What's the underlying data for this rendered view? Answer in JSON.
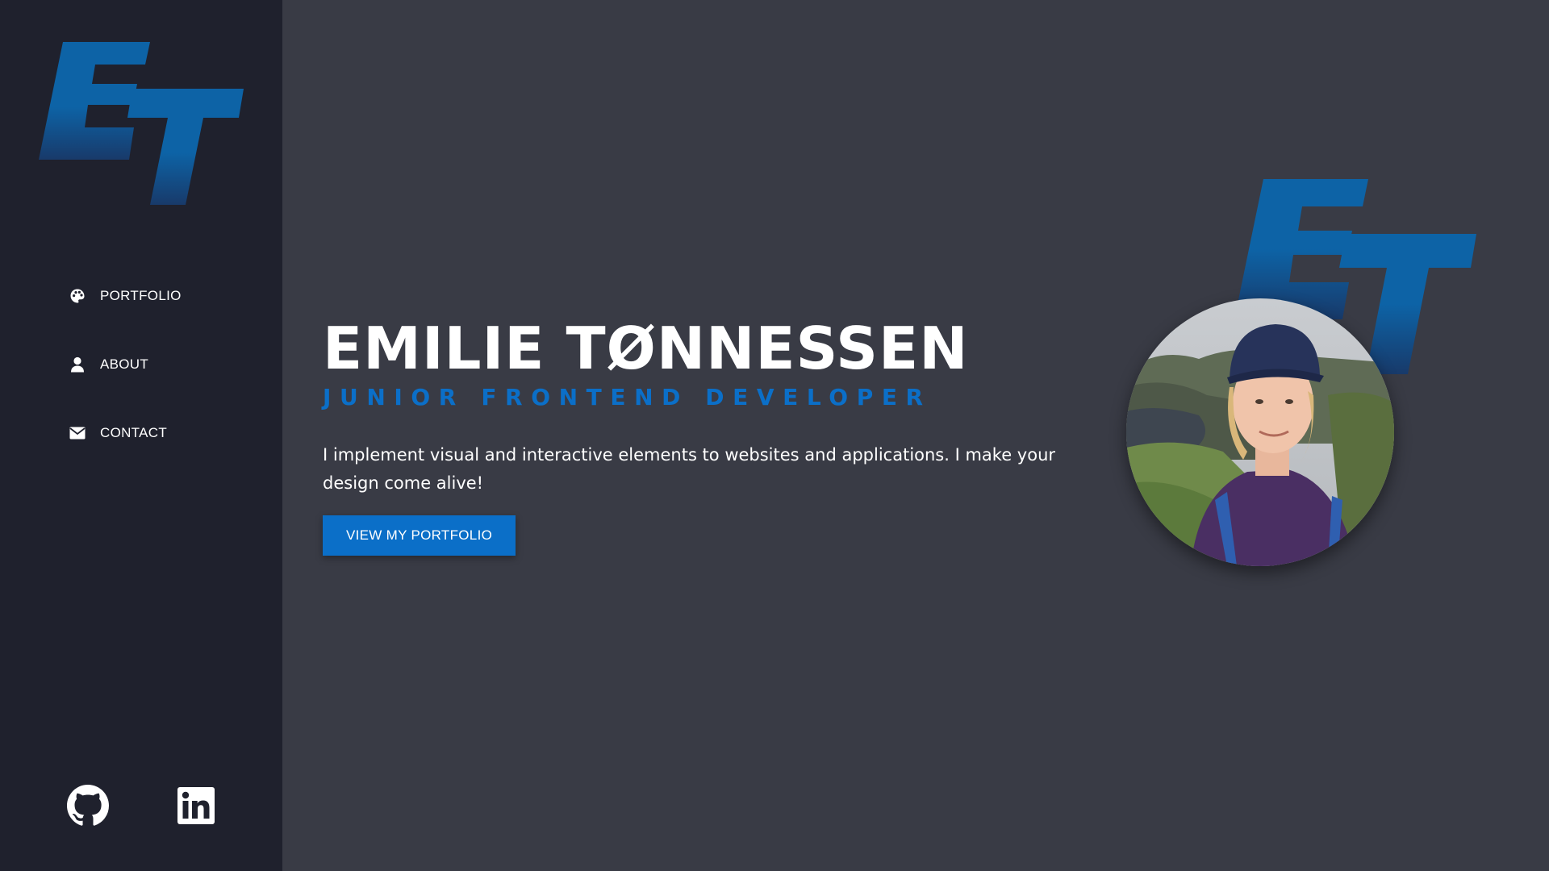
{
  "brand": {
    "initials": "ET",
    "accent": "#0b6fc8"
  },
  "nav": {
    "items": [
      {
        "label": "PORTFOLIO",
        "icon": "palette-icon"
      },
      {
        "label": "ABOUT",
        "icon": "user-icon"
      },
      {
        "label": "CONTACT",
        "icon": "envelope-icon"
      }
    ]
  },
  "social": [
    {
      "icon": "github-icon"
    },
    {
      "icon": "linkedin-icon"
    }
  ],
  "hero": {
    "name": "EMILIE TØNNESSEN",
    "role": "JUNIOR FRONTEND DEVELOPER",
    "description": "I implement visual and interactive elements to websites and applications. I make your design come alive!",
    "cta_label": "VIEW MY PORTFOLIO"
  },
  "colors": {
    "sidebar_bg": "#1f212d",
    "main_bg": "#393b45",
    "accent": "#0b6fc8"
  }
}
